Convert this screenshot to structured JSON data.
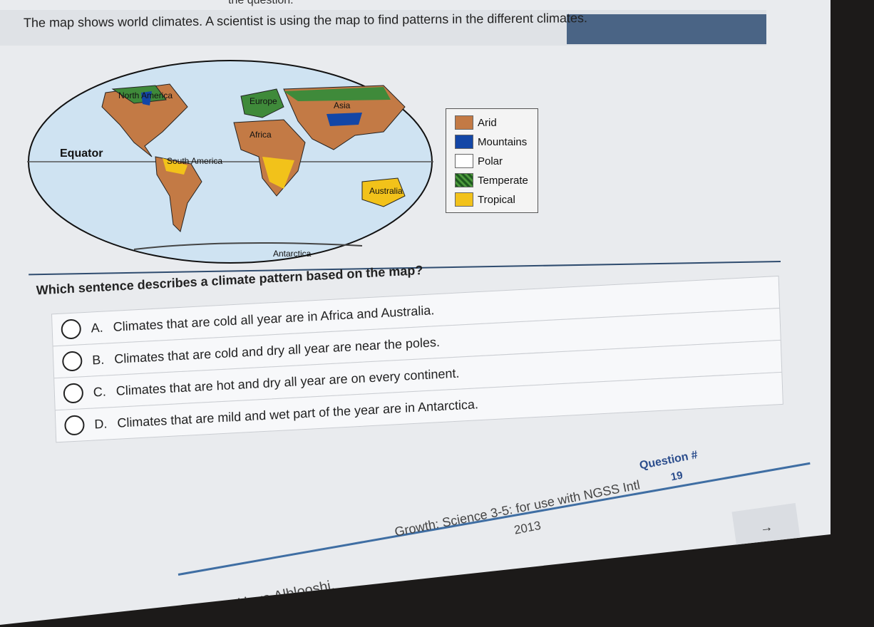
{
  "top_partial_text": "the question.",
  "intro": "The map shows world climates. A scientist is using the map to find patterns in the different climates.",
  "map_labels": {
    "north_america": "North America",
    "europe": "Europe",
    "asia": "Asia",
    "africa": "Africa",
    "equator": "Equator",
    "south_america": "South America",
    "australia": "Australia",
    "antarctica": "Antarctica"
  },
  "legend": [
    {
      "label": "Arid",
      "color": "#c37a45"
    },
    {
      "label": "Mountains",
      "color": "#1346a6"
    },
    {
      "label": "Polar",
      "color": "#ffffff"
    },
    {
      "label": "Temperate",
      "color": "#3f8a3a"
    },
    {
      "label": "Tropical",
      "color": "#f2c21a"
    }
  ],
  "question": "Which sentence describes a climate pattern based on the map?",
  "options": [
    {
      "letter": "A.",
      "text": "Climates that are cold all year are in Africa and Australia."
    },
    {
      "letter": "B.",
      "text": "Climates that are cold and dry all year are near the poles."
    },
    {
      "letter": "C.",
      "text": "Climates that are hot and dry all year are on every continent."
    },
    {
      "letter": "D.",
      "text": "Climates that are mild and wet part of the year are in Antarctica."
    }
  ],
  "footer": {
    "student": "Haya Alblooshi,",
    "course": "Growth: Science 3-5: for use with NGSS Intl",
    "year": "2013",
    "question_label": "Question #",
    "question_number": "19"
  },
  "next_icon": "→"
}
